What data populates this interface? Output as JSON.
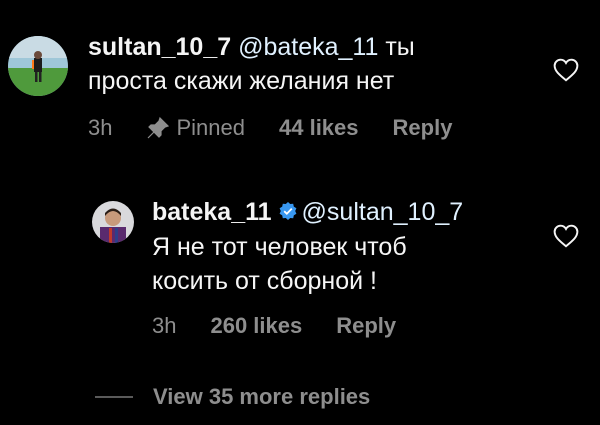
{
  "comment1": {
    "username": "sultan_10_7",
    "mention": "@bateka_11",
    "text_rest": "ты",
    "text_line2": "проста скажи желания нет",
    "time": "3h",
    "pinned": "Pinned",
    "likes": "44 likes",
    "reply": "Reply"
  },
  "comment2": {
    "username": "bateka_11",
    "mention": "@sultan_10_7",
    "text_line1": "Я не тот человек чтоб",
    "text_line2": "косить от сборной !",
    "time": "3h",
    "likes": "260 likes",
    "reply": "Reply"
  },
  "view_more": "View 35 more replies",
  "colors": {
    "background": "#000000",
    "meta": "#8e8e8e",
    "verified": "#3897f0"
  },
  "icons": [
    "pin-icon",
    "heart-icon",
    "verified-icon"
  ]
}
